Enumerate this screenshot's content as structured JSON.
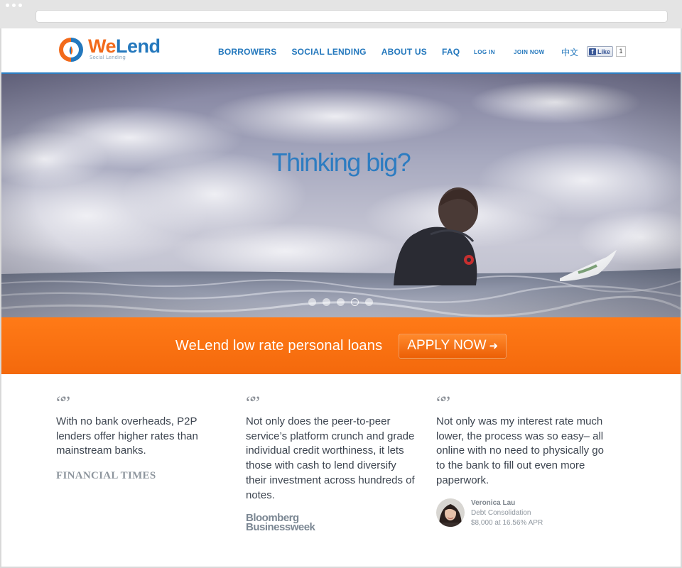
{
  "brand": {
    "name_part1": "We",
    "name_part2": "Lend",
    "tagline": "Social Lending",
    "colors": {
      "orange": "#f26a1b",
      "blue": "#2478bd"
    }
  },
  "nav": {
    "items": [
      "BORROWERS",
      "SOCIAL LENDING",
      "ABOUT US",
      "FAQ"
    ],
    "login": "LOG IN",
    "join": "JOIN NOW",
    "language": "中文"
  },
  "facebook": {
    "icon": "f",
    "label": "Like",
    "count": "1"
  },
  "hero": {
    "title": "Thinking big?",
    "slide_count": 5,
    "active_slide": 4
  },
  "promo": {
    "text": "WeLend low rate personal loans",
    "button": "APPLY NOW",
    "button_icon": "➜"
  },
  "testimonials": [
    {
      "quote_mark": "“”",
      "text": "With no bank overheads, P2P lenders offer higher rates than mainstream banks.",
      "source": "FINANCIAL TIMES"
    },
    {
      "quote_mark": "“”",
      "text": "Not only does the peer-to-peer service’s platform crunch and grade individual credit worthiness, it lets those with cash to lend diversify their investment across hundreds of notes.",
      "source_line1": "Bloomberg",
      "source_line2": "Businessweek"
    },
    {
      "quote_mark": "“”",
      "text": "Not only was my interest rate much lower, the process was so easy– all online with no need to physically go to the bank to fill out even more paperwork.",
      "person_name": "Veronica Lau",
      "person_detail": "Debt Consolidation",
      "person_loan": "$8,000 at 16.56% APR"
    }
  ]
}
